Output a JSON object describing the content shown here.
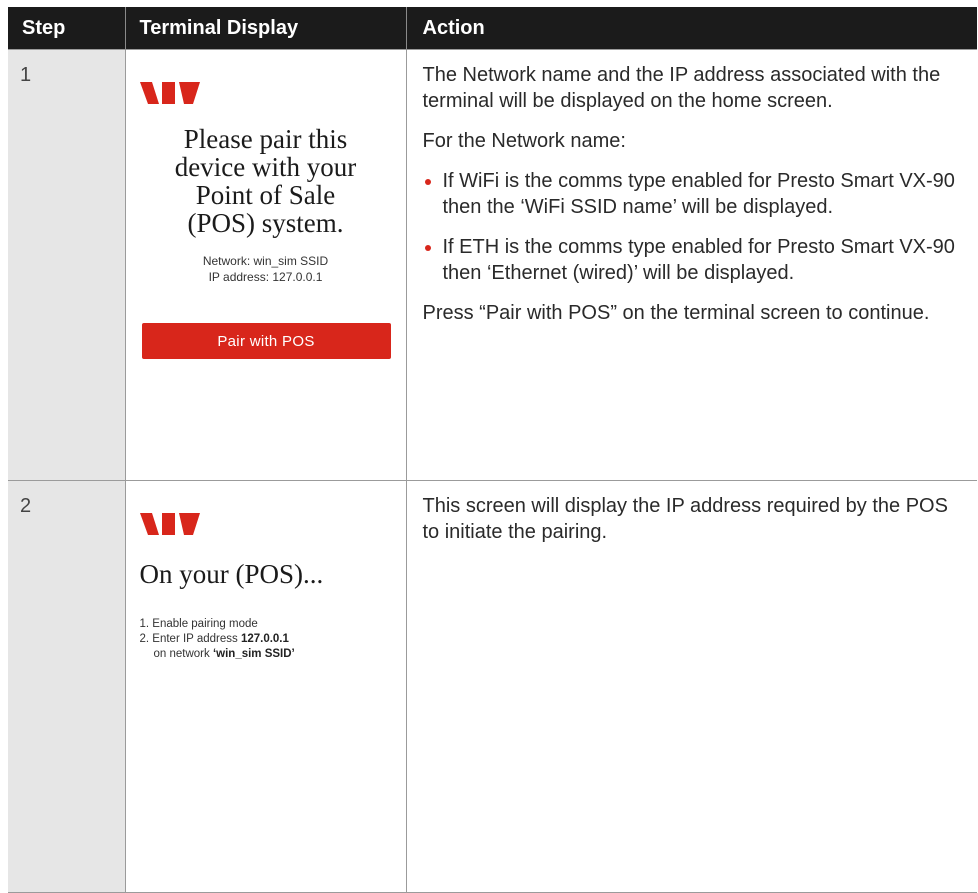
{
  "header": {
    "step": "Step",
    "display": "Terminal Display",
    "action": "Action"
  },
  "colors": {
    "brand_red": "#d8261b",
    "header_bg": "#1b1b1b",
    "step_bg": "#e6e6e6"
  },
  "rows": [
    {
      "step": "1",
      "screen": {
        "logo_icon": "westpac-logo-icon",
        "heading": [
          "Please pair this",
          "device with your",
          "Point of Sale",
          "(POS) system."
        ],
        "network_line": "Network: win_sim SSID",
        "ip_line": "IP address: 127.0.0.1",
        "button": "Pair with POS"
      },
      "action": {
        "intro": "The Network name and the IP address associated with the terminal will be displayed on the home screen.",
        "subhead": "For the Network name:",
        "bullets": [
          "If WiFi is the comms type enabled for Presto Smart VX-90 then the ‘WiFi SSID name’ will be displayed.",
          "If ETH is the comms type enabled for Presto Smart VX-90 then ‘Ethernet (wired)’ will be displayed."
        ],
        "outro": "Press “Pair with POS” on the terminal screen to continue."
      }
    },
    {
      "step": "2",
      "screen": {
        "logo_icon": "westpac-logo-icon",
        "heading": "On your (POS)...",
        "item1": "1. Enable pairing mode",
        "item2_prefix": "2. Enter IP address ",
        "item2_ip": "127.0.0.1",
        "item2_cont": "on network ",
        "item2_network": "‘win_sim SSID’"
      },
      "action": {
        "text": "This screen will display the IP address required by the POS to initiate the pairing."
      }
    }
  ]
}
